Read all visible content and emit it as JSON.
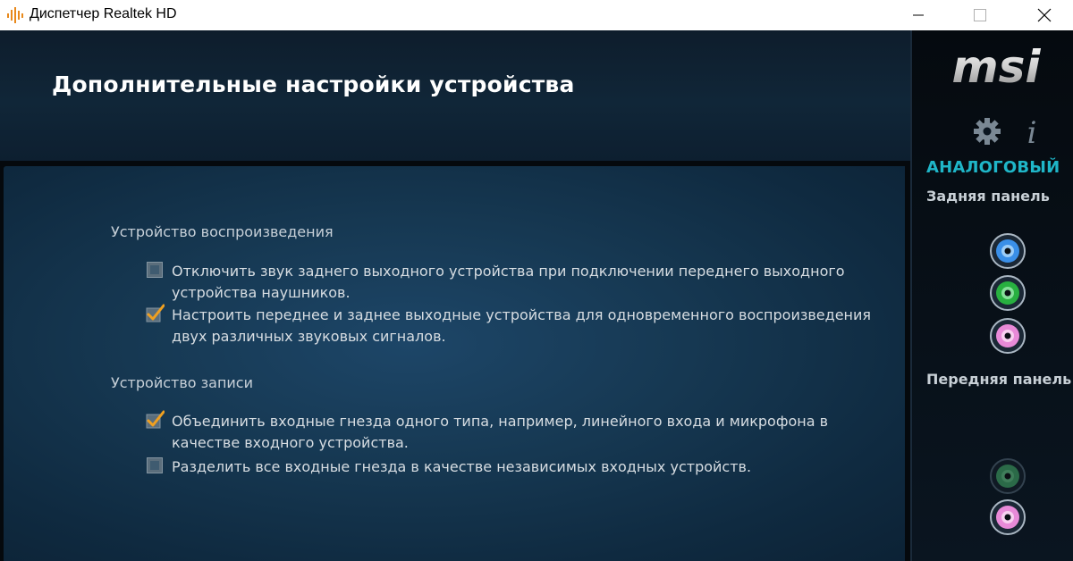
{
  "window": {
    "title": "Диспетчер Realtek HD"
  },
  "header": {
    "title": "Дополнительные настройки устройства"
  },
  "playback": {
    "section_title": "Устройство воспроизведения",
    "options": [
      {
        "label": "Отключить звук заднего выходного устройства при подключении переднего выходного устройства наушников.",
        "checked": false
      },
      {
        "label": "Настроить переднее и заднее выходные устройства для одновременного воспроизведения двух различных звуковых сигналов.",
        "checked": true
      }
    ]
  },
  "recording": {
    "section_title": "Устройство записи",
    "options": [
      {
        "label": "Объединить входные гнезда одного типа, например, линейного входа и микрофона в качестве входного устройства.",
        "checked": true
      },
      {
        "label": "Разделить все входные гнезда в качестве независимых входных устройств.",
        "checked": false
      }
    ]
  },
  "sidebar": {
    "logo_text": "msi",
    "analog_label": "АНАЛОГОВЫЙ",
    "back_panel_label": "Задняя панель",
    "front_panel_label": "Передняя панель",
    "back_jacks": [
      {
        "color": "#3a8fe8"
      },
      {
        "color": "#28b040"
      },
      {
        "color": "#e88ad8"
      }
    ],
    "front_jacks": [
      {
        "color": "#2b6a48",
        "dimmed": true
      },
      {
        "color": "#e88ad8"
      }
    ]
  },
  "colors": {
    "accent": "#1fb6c8",
    "checkmark": "#f0a020"
  }
}
